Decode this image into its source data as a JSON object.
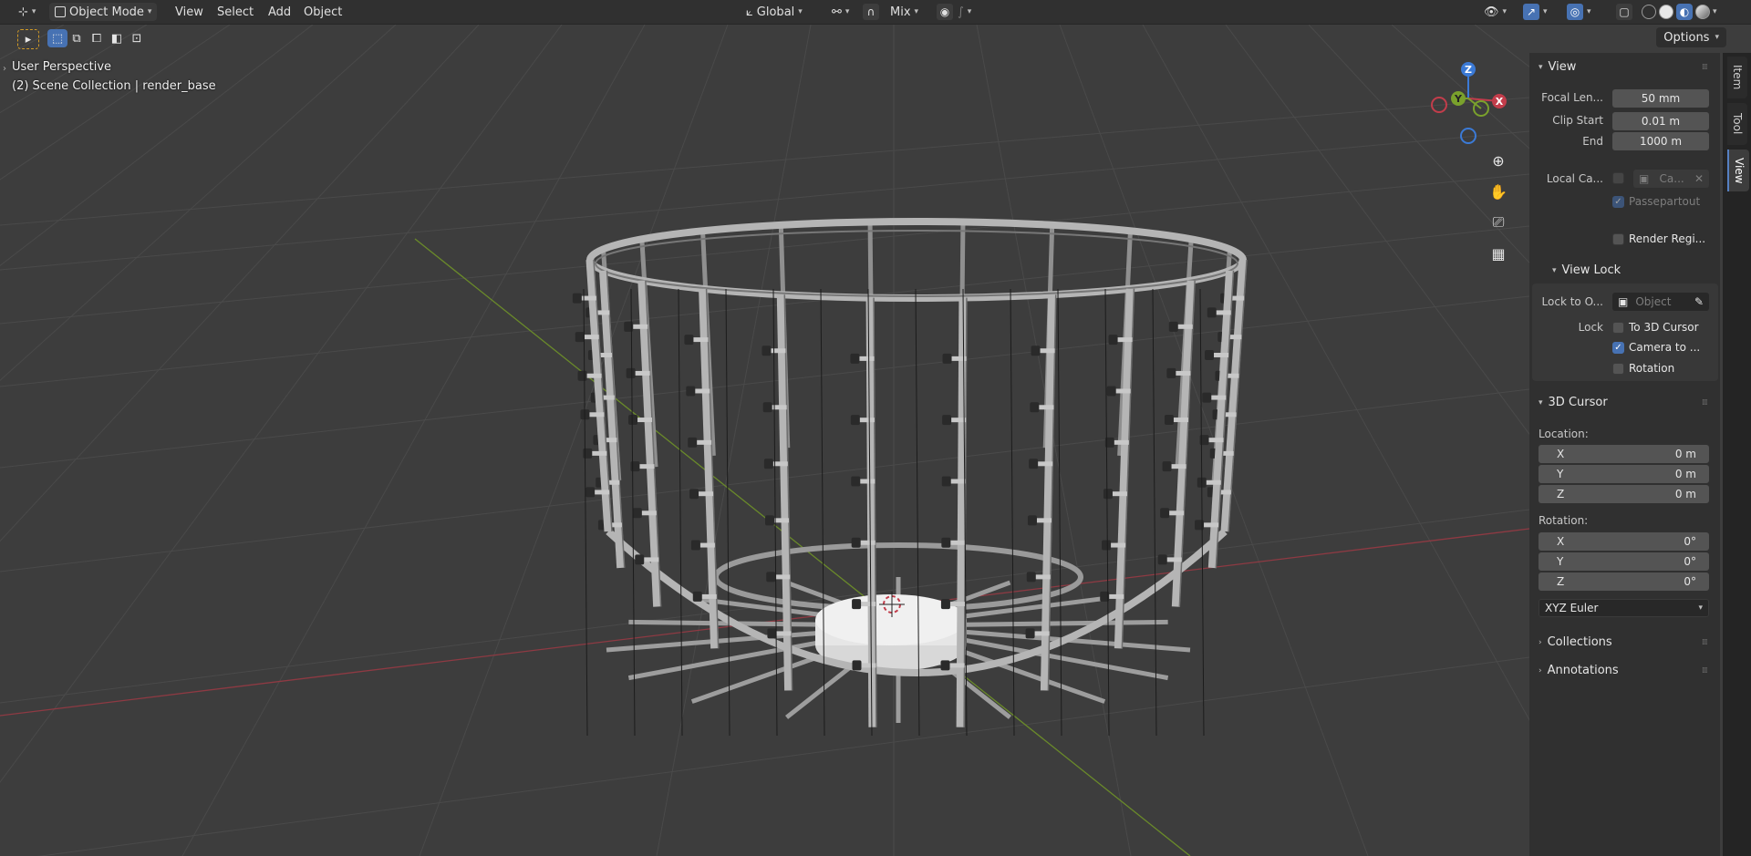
{
  "header": {
    "editor_type_icon": "axis-icon",
    "mode_label": "Object Mode",
    "menus": [
      "View",
      "Select",
      "Add",
      "Object"
    ],
    "transform_orientation": "Global",
    "snap_target": "Mix"
  },
  "toolbar": {
    "options_label": "Options"
  },
  "viewport": {
    "perspective_label": "User Perspective",
    "collection_label": "(2) Scene Collection | render_base",
    "gizmo": {
      "z": "Z",
      "y": "Y",
      "x": "X"
    }
  },
  "sidebar": {
    "tabs": [
      "Item",
      "Tool",
      "View"
    ],
    "active_tab": "View",
    "view_panel": {
      "title": "View",
      "focal_length_label": "Focal Len...",
      "focal_length_value": "50 mm",
      "clip_start_label": "Clip Start",
      "clip_start_value": "0.01 m",
      "end_label": "End",
      "end_value": "1000 m",
      "local_camera_label": "Local Ca...",
      "local_camera_value": "Ca...",
      "passepartout_label": "Passepartout",
      "render_region_label": "Render Regi..."
    },
    "view_lock": {
      "title": "View Lock",
      "lock_to_object_label": "Lock to O...",
      "lock_to_object_placeholder": "Object",
      "lock_label": "Lock",
      "to_3d_cursor_label": "To 3D Cursor",
      "camera_to_view_label": "Camera to ...",
      "camera_to_view_checked": true,
      "rotation_label": "Rotation"
    },
    "cursor_panel": {
      "title": "3D Cursor",
      "location_label": "Location:",
      "location": [
        {
          "axis": "X",
          "value": "0 m"
        },
        {
          "axis": "Y",
          "value": "0 m"
        },
        {
          "axis": "Z",
          "value": "0 m"
        }
      ],
      "rotation_label": "Rotation:",
      "rotation": [
        {
          "axis": "X",
          "value": "0°"
        },
        {
          "axis": "Y",
          "value": "0°"
        },
        {
          "axis": "Z",
          "value": "0°"
        }
      ],
      "rotation_mode": "XYZ Euler"
    },
    "collections_title": "Collections",
    "annotations_title": "Annotations"
  },
  "colors": {
    "viewport_bg": "#3d3d3d",
    "header_bg": "#303030",
    "accent": "#4772b3",
    "x_axis": "#c23d4b",
    "y_axis": "#7aa12c",
    "z_axis": "#3b7ad6"
  }
}
